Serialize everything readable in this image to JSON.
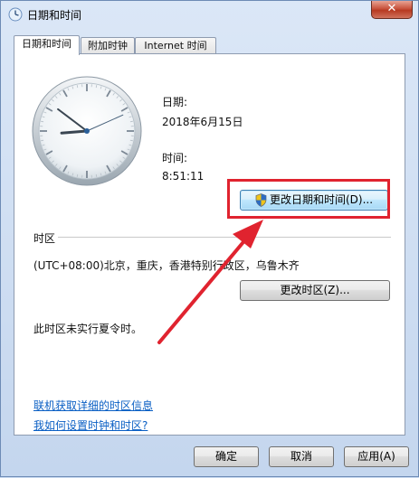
{
  "window": {
    "title": "日期和时间",
    "close_glyph": "✕"
  },
  "tabs": [
    {
      "label": "日期和时间"
    },
    {
      "label": "附加时钟"
    },
    {
      "label": "Internet 时间"
    }
  ],
  "datetime": {
    "date_label": "日期:",
    "date_value": "2018年6月15日",
    "time_label": "时间:",
    "time_value": "8:51:11",
    "change_button": "更改日期和时间(D)..."
  },
  "timezone": {
    "section_label": "时区",
    "value": "(UTC+08:00)北京，重庆，香港特别行政区，乌鲁木齐",
    "change_button": "更改时区(Z)...",
    "dst_note": "此时区未实行夏令时。"
  },
  "links": [
    {
      "text": "联机获取详细的时区信息"
    },
    {
      "text": "我如何设置时钟和时区?"
    }
  ],
  "footer": {
    "ok_button": "确定",
    "cancel_button": "取消",
    "apply_button": "应用(A)"
  },
  "clock": {
    "hours": 8,
    "minutes": 51,
    "seconds": 11
  },
  "colors": {
    "annotation_red": "#e0232f",
    "link_blue": "#0a5fc4"
  },
  "icons": {
    "title": "clock-globe-icon",
    "uac": "uac-shield-icon"
  }
}
